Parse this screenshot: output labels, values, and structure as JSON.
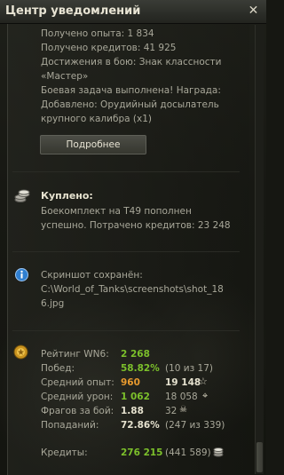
{
  "window": {
    "title": "Центр уведомлений"
  },
  "notification1": {
    "lines": [
      "Получено опыта: 1 834",
      "Получено кредитов: 41 925",
      "Достижения в бою: Знак классности",
      "«Мастер»",
      "Боевая задача выполнена! Награда:",
      "Добавлено: Орудийный досылатель",
      "крупного калибра (x1)"
    ],
    "button_label": "Подробнее"
  },
  "notification2": {
    "icon": "coins-icon",
    "title": "Куплено:",
    "lines": [
      "Боекомплект на T49 пополнен",
      "успешно. Потрачено кредитов:  23 248"
    ]
  },
  "notification3": {
    "icon": "info-icon",
    "lines": [
      "Скриншот сохранён:",
      "C:\\World_of_Tanks\\screenshots\\shot_18",
      "6.jpg"
    ]
  },
  "notification4": {
    "icon": "rating-medal-icon",
    "stats": {
      "rating": {
        "label": "Рейтинг WN6:",
        "value": "2 268"
      },
      "wins": {
        "label": "Побед:",
        "value": "58.82%",
        "extra": "(10 из 17)"
      },
      "avg_xp": {
        "label": "Средний опыт:",
        "value": "960",
        "value2": "19 148"
      },
      "avg_dmg": {
        "label": "Средний урон:",
        "value": "1 062",
        "value2": "18 058"
      },
      "frags": {
        "label": "Фрагов за бой:",
        "value": "1.88",
        "value2": "32"
      },
      "hits": {
        "label": "Попаданий:",
        "value": "72.86%",
        "extra": "(247 из 339)"
      },
      "credits": {
        "label": "Кредиты:",
        "value": "276 215",
        "extra": "(441 589)"
      }
    }
  },
  "colors": {
    "green": "#7cc02b",
    "orange": "#e89a2e",
    "text": "#a9a89a",
    "highlight": "#e6e2cf"
  }
}
